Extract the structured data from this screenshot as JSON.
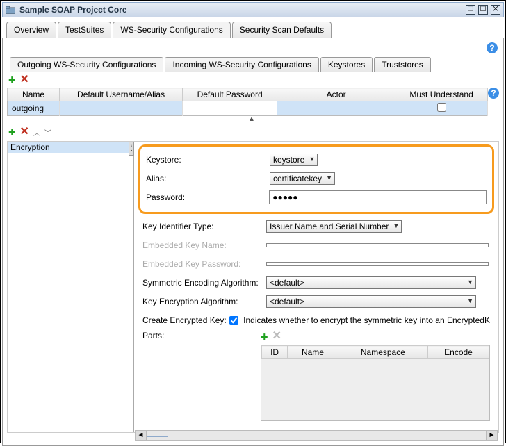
{
  "window": {
    "title": "Sample SOAP Project Core"
  },
  "mainTabs": [
    "Overview",
    "TestSuites",
    "WS-Security Configurations",
    "Security Scan Defaults"
  ],
  "mainActive": 2,
  "subTabs": [
    "Outgoing WS-Security Configurations",
    "Incoming WS-Security Configurations",
    "Keystores",
    "Truststores"
  ],
  "subActive": 0,
  "table1": {
    "headers": [
      "Name",
      "Default Username/Alias",
      "Default Password",
      "Actor",
      "Must Understand"
    ],
    "row": {
      "name": "outgoing",
      "alias": "",
      "password": "",
      "actor": "",
      "must": false
    }
  },
  "encList": [
    "Encryption"
  ],
  "form": {
    "keystoreLabel": "Keystore:",
    "keystoreValue": "keystore",
    "aliasLabel": "Alias:",
    "aliasValue": "certificatekey",
    "passwordLabel": "Password:",
    "passwordValue": "●●●●●",
    "keyIdTypeLabel": "Key Identifier Type:",
    "keyIdTypeValue": "Issuer Name and Serial Number",
    "embKeyNameLabel": "Embedded Key Name:",
    "embKeyNameValue": "",
    "embKeyPwdLabel": "Embedded Key Password:",
    "embKeyPwdValue": "",
    "symAlgoLabel": "Symmetric Encoding Algorithm:",
    "symAlgoValue": "<default>",
    "keyEncAlgoLabel": "Key Encryption Algorithm:",
    "keyEncAlgoValue": "<default>",
    "createKeyLabel": "Create Encrypted Key:",
    "createKeyChecked": true,
    "createKeyText": "Indicates whether to encrypt the symmetric key into an EncryptedK",
    "partsLabel": "Parts:",
    "partsHeaders": [
      "ID",
      "Name",
      "Namespace",
      "Encode"
    ]
  }
}
